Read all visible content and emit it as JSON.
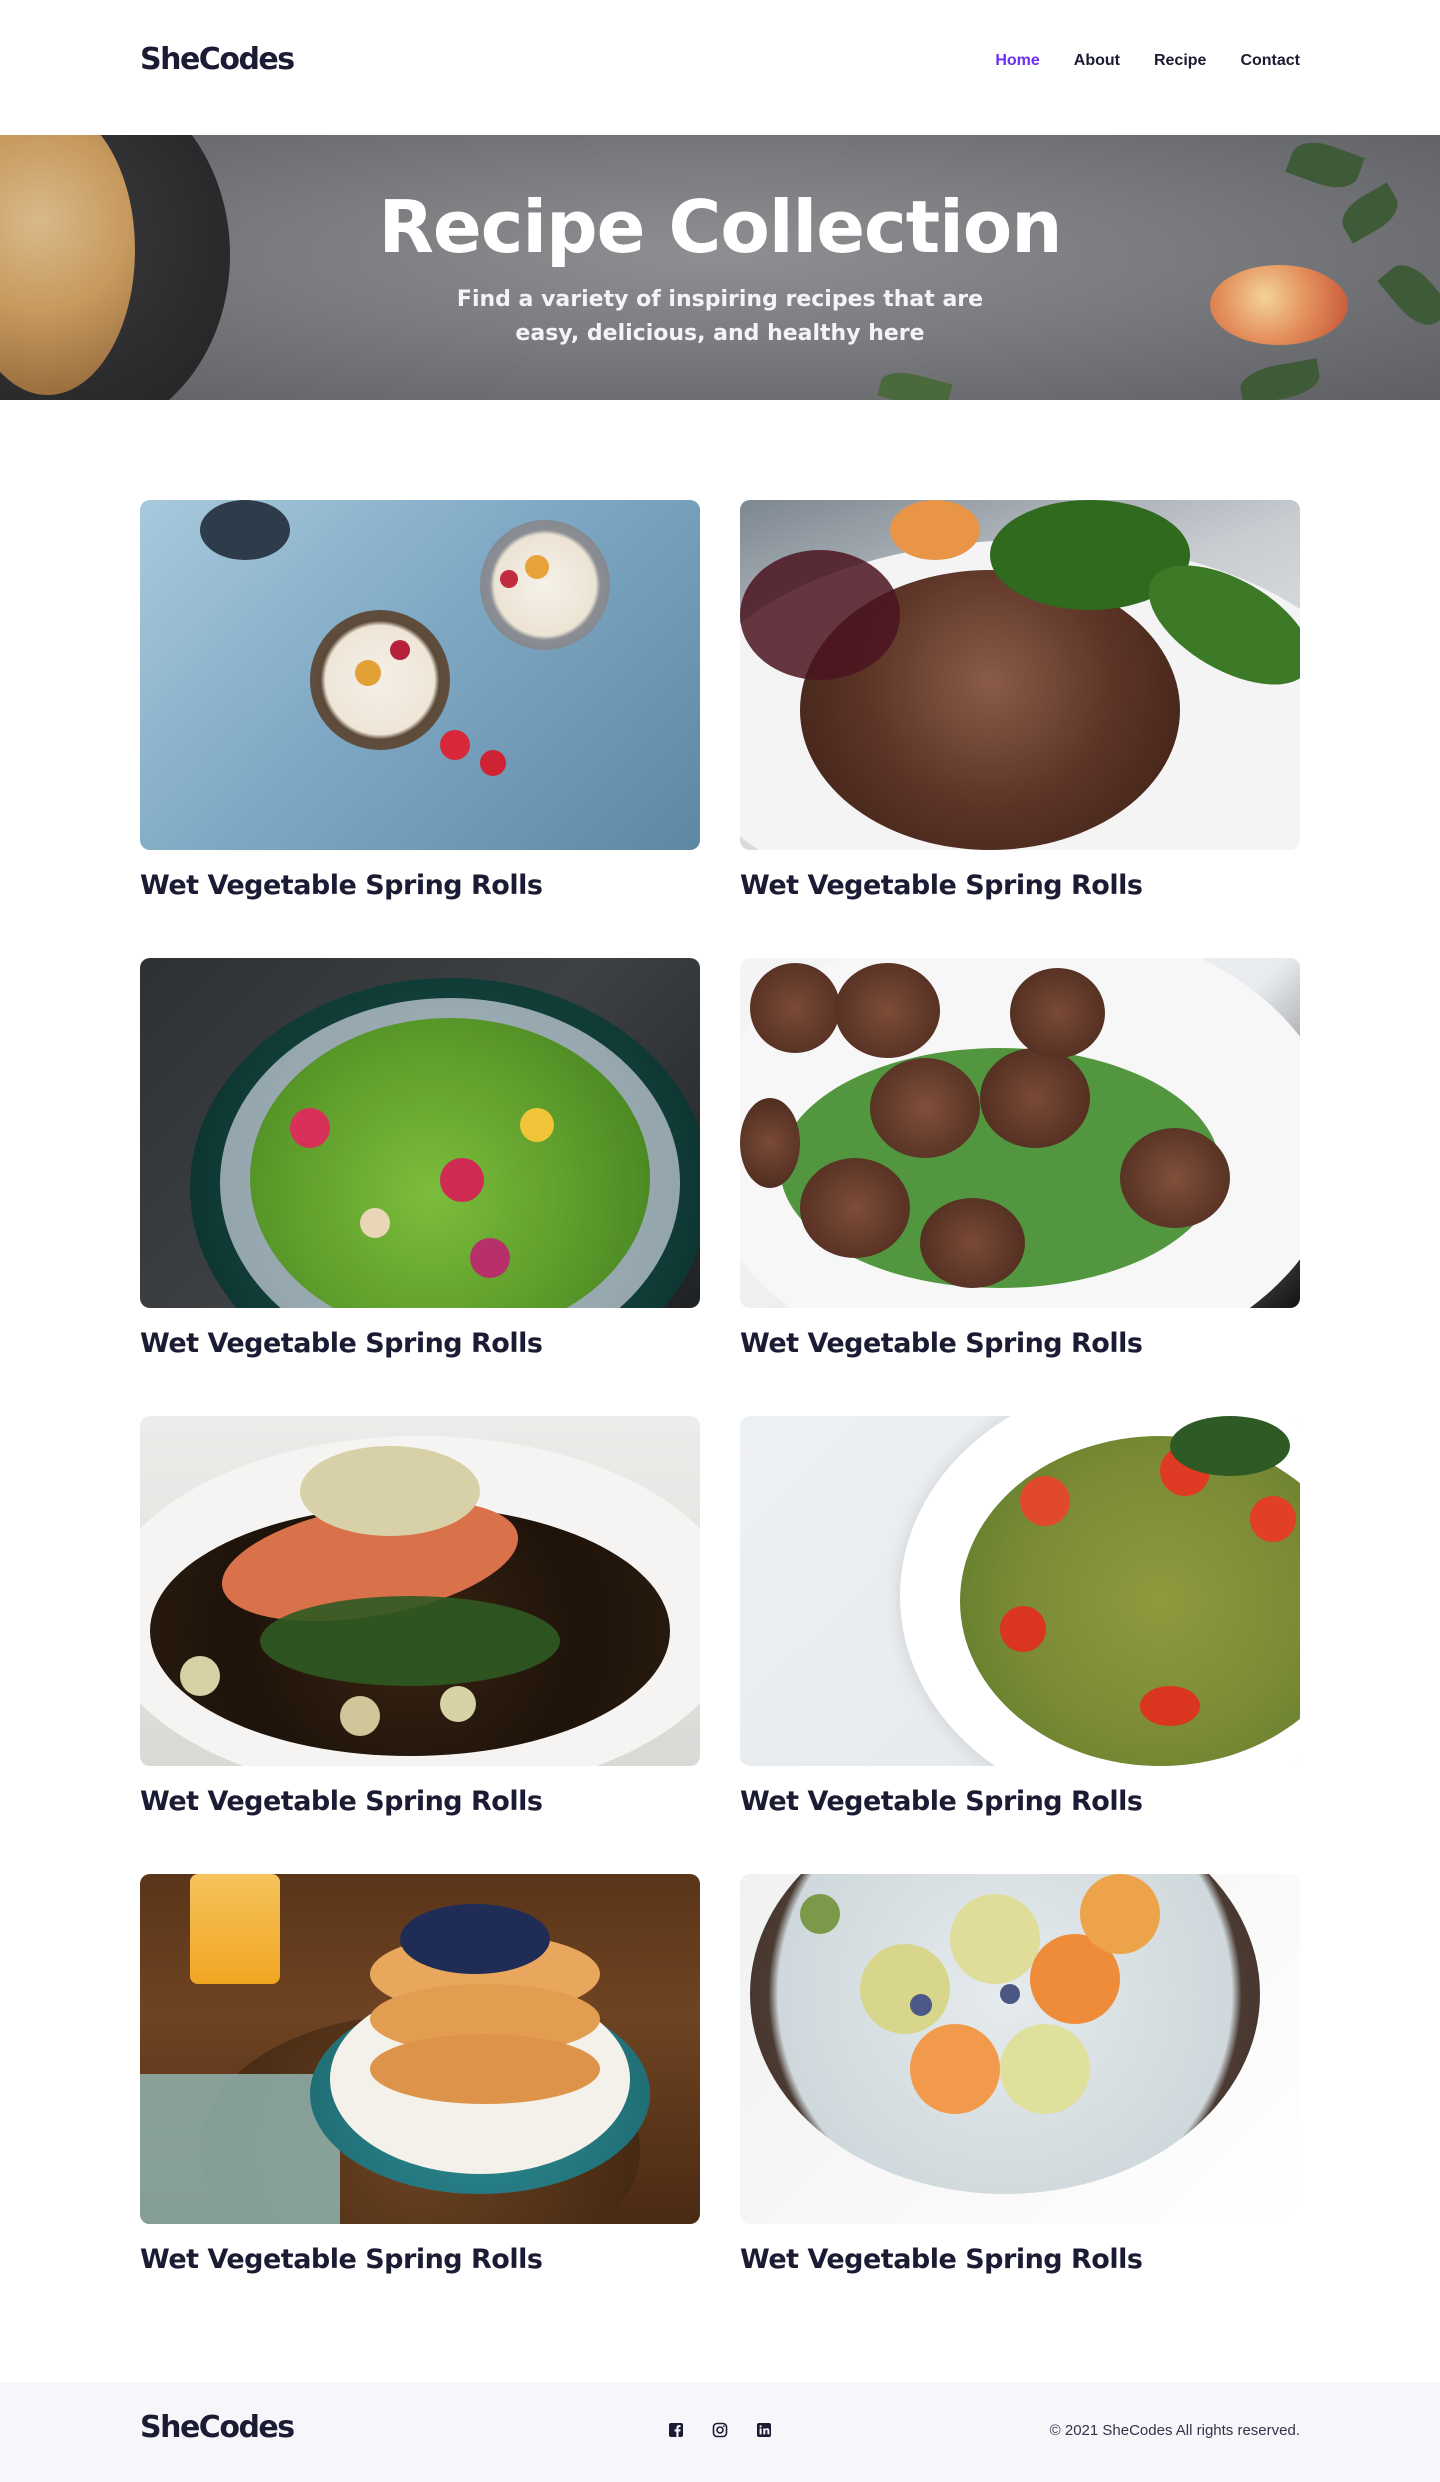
{
  "brand": {
    "name": "SheCodes"
  },
  "nav": {
    "items": [
      {
        "label": "Home",
        "active": true
      },
      {
        "label": "About",
        "active": false
      },
      {
        "label": "Recipe",
        "active": false
      },
      {
        "label": "Contact",
        "active": false
      }
    ]
  },
  "hero": {
    "title": "Recipe Collection",
    "subtitle": "Find a variety of inspiring recipes that are easy, delicious, and healthy here"
  },
  "recipes": [
    {
      "title": "Wet Vegetable Spring Rolls"
    },
    {
      "title": "Wet Vegetable Spring Rolls"
    },
    {
      "title": "Wet Vegetable Spring Rolls"
    },
    {
      "title": "Wet Vegetable Spring Rolls"
    },
    {
      "title": "Wet Vegetable Spring Rolls"
    },
    {
      "title": "Wet Vegetable Spring Rolls"
    },
    {
      "title": "Wet Vegetable Spring Rolls"
    },
    {
      "title": "Wet Vegetable Spring Rolls"
    }
  ],
  "footer": {
    "brand": "SheCodes",
    "copyright": "© 2021 SheCodes All rights reserved.",
    "socials": [
      "facebook-icon",
      "instagram-icon",
      "linkedin-icon"
    ]
  },
  "colors": {
    "accent": "#6c2ef2",
    "text": "#1b1b34",
    "footer_bg": "#f6f6fb"
  }
}
